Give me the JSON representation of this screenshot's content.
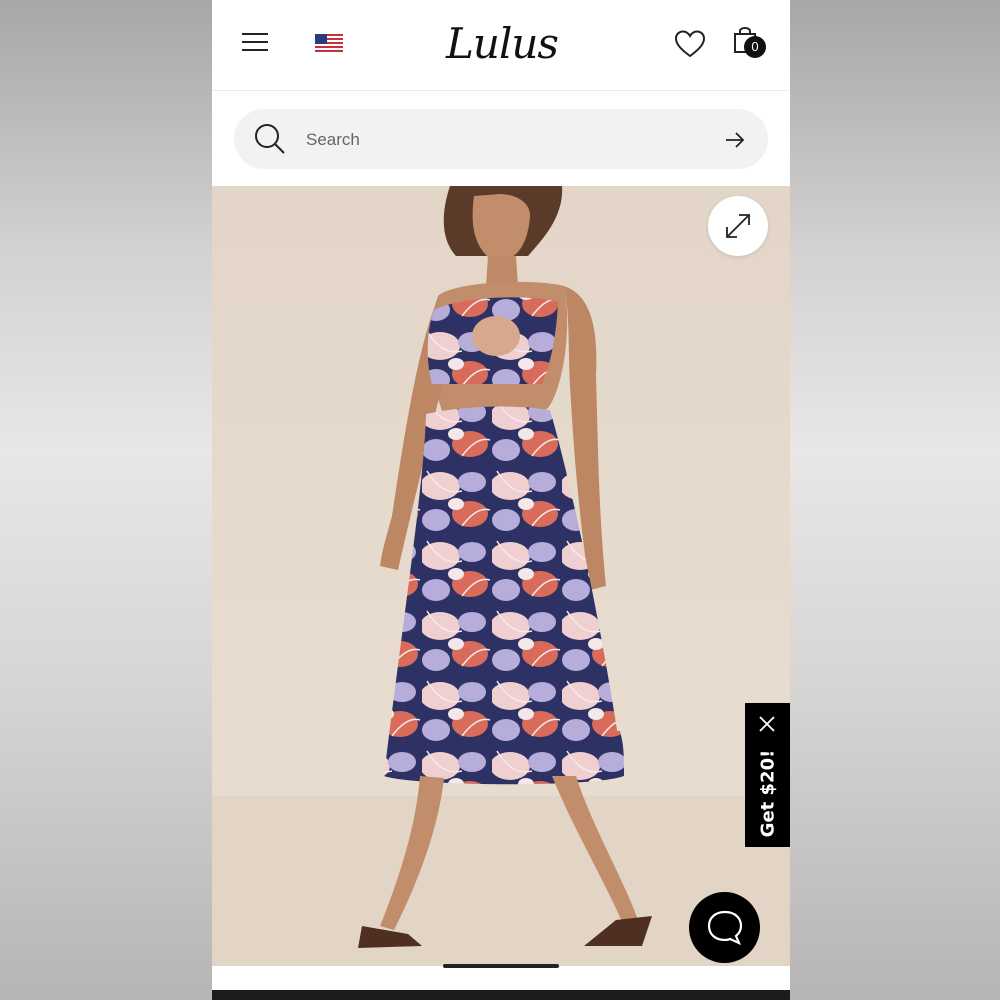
{
  "header": {
    "logo_text": "Lulus",
    "menu_icon": "hamburger-menu-icon",
    "flag_icon": "us-flag-icon",
    "wishlist_icon": "heart-icon",
    "bag_icon": "shopping-bag-icon",
    "bag_count": "0"
  },
  "search": {
    "placeholder": "Search",
    "value": "",
    "icon": "search-icon",
    "submit_icon": "arrow-right-icon"
  },
  "hero": {
    "image": "product-photo-floral-two-piece-set",
    "expand_icon": "expand-icon"
  },
  "promo": {
    "label": "Get $20!",
    "close_icon": "close-icon"
  },
  "chat": {
    "icon": "chat-bubble-icon"
  },
  "colors": {
    "navy": "#2e3163",
    "coral": "#d96b5b",
    "lavender": "#b7addb",
    "blush": "#f0cfd0",
    "background": "#e3d6c8"
  }
}
